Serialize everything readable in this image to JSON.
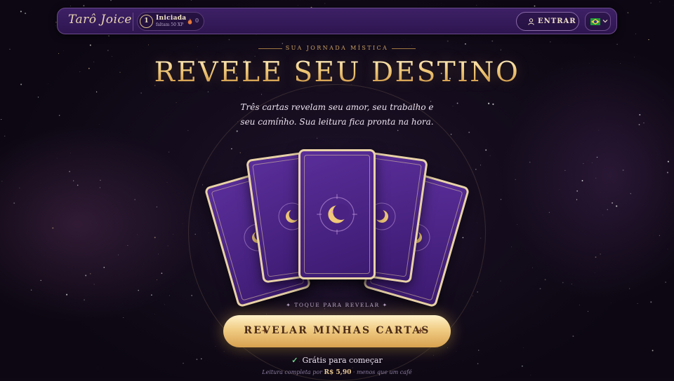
{
  "header": {
    "logo": "Tarô Joice",
    "level": {
      "number": "1",
      "name": "Iniciada",
      "xp_remaining": "faltam 50 XP"
    },
    "streak": "0",
    "login_label": "ENTRAR",
    "language_flag": "brazil-flag"
  },
  "hero": {
    "eyebrow": "SUA JORNADA MÍSTICA",
    "title": "REVELE SEU DESTINO",
    "subtitle_line1": "Três cartas revelam seu amor, seu trabalho e",
    "subtitle_line2": "seu caminho. Sua leitura fica pronta na hora.",
    "tap_hint": "✦ TOQUE PARA REVELAR ✦",
    "cta_label": "REVELAR MINHAS CARTAS",
    "free_text": "Grátis para começar",
    "price_prefix": "Leitura completa por",
    "price_value": "R$ 5,90",
    "price_suffix": "· menos que um café"
  },
  "colors": {
    "accent_gold": "#f0c878",
    "card_purple": "#4a2282",
    "bar_purple": "#3d2066",
    "check_green": "#6fd08a"
  }
}
